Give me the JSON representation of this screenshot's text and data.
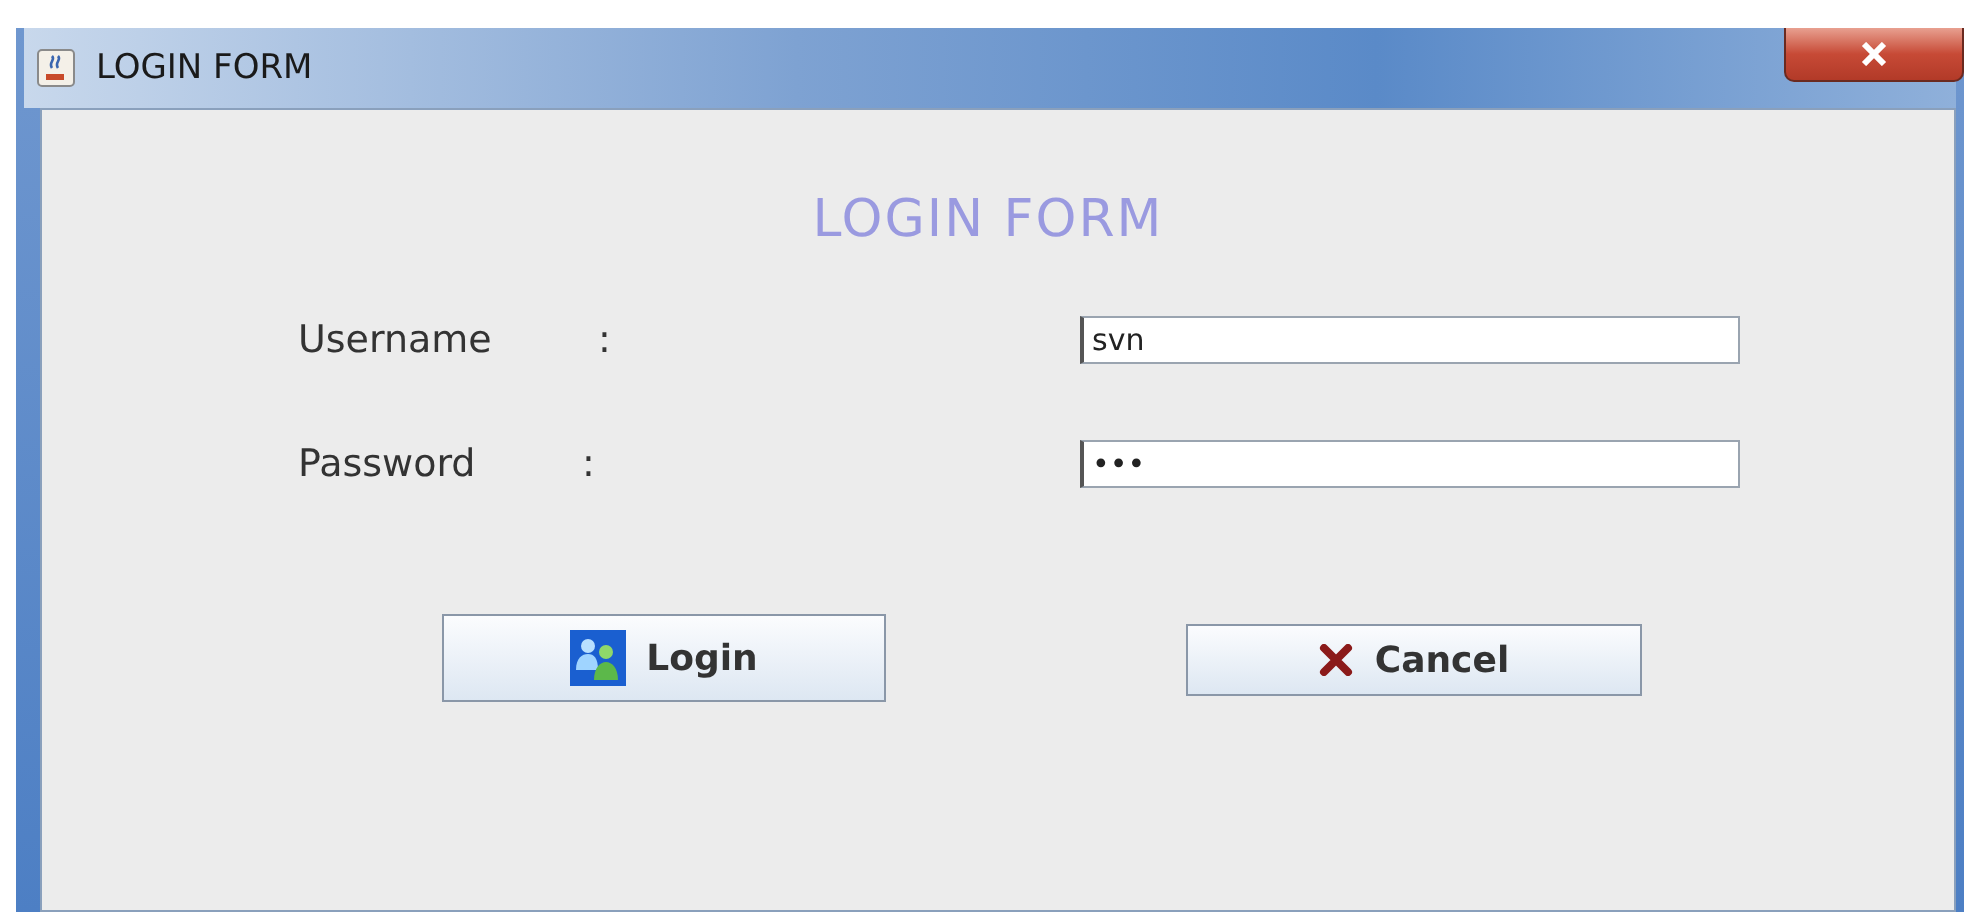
{
  "window": {
    "title": "LOGIN FORM"
  },
  "form": {
    "heading": "LOGIN FORM",
    "fields": [
      {
        "label": "Username",
        "separator": ":",
        "value": "svn"
      },
      {
        "label": "Password",
        "separator": ":",
        "value": "•••"
      }
    ],
    "buttons": [
      {
        "label": "Login"
      },
      {
        "label": "Cancel"
      }
    ]
  }
}
